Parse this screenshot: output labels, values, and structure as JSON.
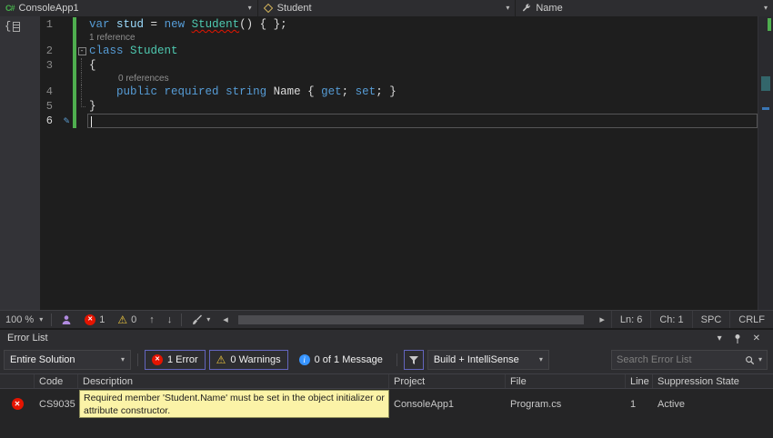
{
  "navbar": {
    "project": "ConsoleApp1",
    "type": "Student",
    "member": "Name"
  },
  "editor": {
    "rows": [
      {
        "kind": "code",
        "num": "1",
        "tokens": [
          [
            "var",
            "kw"
          ],
          [
            " ",
            ""
          ],
          [
            "stud",
            "local"
          ],
          [
            " = ",
            ""
          ],
          [
            "new",
            "kw"
          ],
          [
            " ",
            ""
          ],
          [
            "Student",
            "type-err"
          ],
          [
            "() { };",
            ""
          ]
        ]
      },
      {
        "kind": "lens",
        "text": "1 reference",
        "indent": 0
      },
      {
        "kind": "code",
        "num": "2",
        "fold": "minus",
        "tokens": [
          [
            "class",
            "kw"
          ],
          [
            " ",
            ""
          ],
          [
            "Student",
            "type"
          ]
        ]
      },
      {
        "kind": "code",
        "num": "3",
        "fold": "line",
        "tokens": [
          [
            "{",
            ""
          ]
        ]
      },
      {
        "kind": "lens",
        "text": "0 references",
        "indent": 1,
        "fold": "line"
      },
      {
        "kind": "code",
        "num": "4",
        "fold": "line",
        "tokens": [
          [
            "    ",
            ""
          ],
          [
            "public",
            "kw"
          ],
          [
            " ",
            ""
          ],
          [
            "required",
            "kw"
          ],
          [
            " ",
            ""
          ],
          [
            "string",
            "kw"
          ],
          [
            " ",
            ""
          ],
          [
            "Name",
            ""
          ],
          [
            " { ",
            ""
          ],
          [
            "get",
            "kw"
          ],
          [
            "; ",
            ""
          ],
          [
            "set",
            "kw"
          ],
          [
            "; }",
            ""
          ]
        ]
      },
      {
        "kind": "code",
        "num": "5",
        "fold": "end",
        "tokens": [
          [
            "}",
            ""
          ]
        ]
      },
      {
        "kind": "code",
        "num": "6",
        "current": true,
        "tokens": []
      }
    ]
  },
  "status": {
    "zoom": "100 %",
    "error_count": "1",
    "warning_count": "0",
    "line": "Ln: 6",
    "column": "Ch: 1",
    "spaces": "SPC",
    "line_ending": "CRLF"
  },
  "error_list": {
    "title": "Error List",
    "filter_scope": "Entire Solution",
    "errors_button": "1 Error",
    "warnings_button": "0 Warnings",
    "messages_button": "0 of 1 Message",
    "source_filter": "Build + IntelliSense",
    "search_placeholder": "Search Error List",
    "columns": [
      "Code",
      "Description",
      "Project",
      "File",
      "Line",
      "Suppression State"
    ],
    "rows": [
      {
        "code": "CS9035",
        "description": "Required member 'Student.Name' must be set in the object initializer or attribute constructor.",
        "project": "ConsoleApp1",
        "file": "Program.cs",
        "line": "1",
        "suppression_state": "Active"
      }
    ],
    "tooltip_lines": [
      "Required member 'Student.Name' must be set in the object initializer or",
      "attribute constructor."
    ]
  },
  "icons": {
    "caret_down": "▾",
    "cross": "✕",
    "warning": "⚠",
    "info_i": "i",
    "arrow_up": "↑",
    "arrow_down": "↓",
    "scroll_left": "◂",
    "scroll_right": "▸",
    "pencil": "✎",
    "csharp": "C#",
    "brace": "{",
    "fold_minus": "-"
  },
  "colors": {
    "keyword": "#569cd6",
    "type": "#4ec9b0",
    "local": "#9cdcfe",
    "error_red": "#e51400",
    "warning_yellow": "#eec73e",
    "info_blue": "#3794ff",
    "change_green": "#4fae4f",
    "accent_border": "#6365bd",
    "tooltip_bg": "#fbf3a7",
    "tooltip_border": "#8d8d5a",
    "tooltip_text": "#1e1e1e"
  }
}
